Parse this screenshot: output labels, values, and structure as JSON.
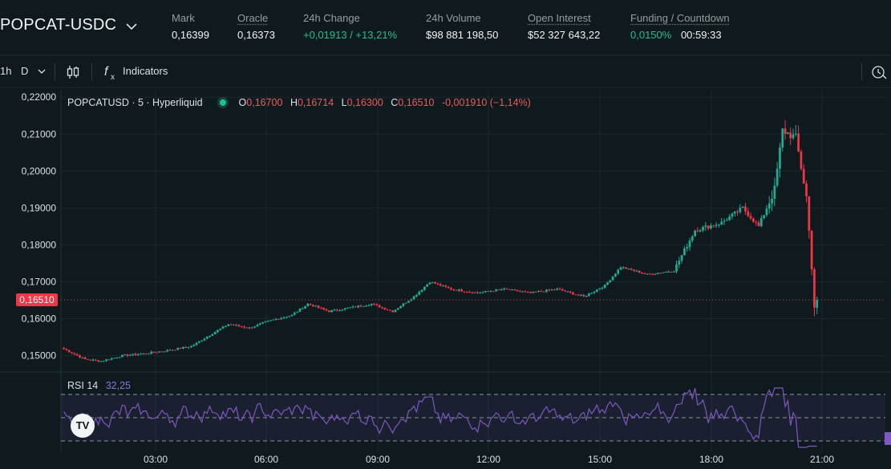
{
  "header": {
    "pair": "POPCAT-USDC",
    "stats": [
      {
        "label": "Mark",
        "value": "0,16399",
        "underline": false
      },
      {
        "label": "Oracle",
        "value": "0,16373",
        "underline": true
      },
      {
        "label": "24h Change",
        "value": "+0,01913 / +13,21%",
        "underline": false,
        "color": "#1fbf8f"
      },
      {
        "label": "24h Volume",
        "value": "$98 881 198,50",
        "underline": false
      },
      {
        "label": "Open Interest",
        "value": "$52 327 643,22",
        "underline": true
      },
      {
        "label": "Funding / Countdown",
        "value": "0,0150%",
        "value2": "00:59:33",
        "underline": true
      }
    ]
  },
  "toolbar": {
    "interval_1h": "1h",
    "interval_d": "D",
    "indicators_label": "Indicators"
  },
  "legend": {
    "symbol": "POPCATUSD · 5 · Hyperliquid",
    "o_label": "O",
    "o_value": "0,16700",
    "h_label": "H",
    "h_value": "0,16714",
    "l_label": "L",
    "l_value": "0,16300",
    "c_label": "C",
    "c_value": "0,16510",
    "change": "-0,001910 (−1,14%)"
  },
  "price_axis": [
    "0,22000",
    "0,21000",
    "0,20000",
    "0,19000",
    "0,18000",
    "0,17000",
    "0,16000",
    "0,15000"
  ],
  "price_axis_values": [
    0.22,
    0.21,
    0.2,
    0.19,
    0.18,
    0.17,
    0.16,
    0.15
  ],
  "last_price": {
    "label": "0,16510",
    "value": 0.1651
  },
  "time_axis": [
    "03:00",
    "06:00",
    "09:00",
    "12:00",
    "15:00",
    "18:00",
    "21:00"
  ],
  "rsi": {
    "label": "RSI",
    "period": "14",
    "value": "32,25"
  },
  "colors": {
    "up": "#22ab94",
    "down": "#f23645",
    "rsi": "#7e57c2",
    "background": "#0f1a1f"
  },
  "chart_data": {
    "type": "candlestick",
    "ylim": [
      0.146,
      0.222
    ],
    "keypoints_close": [
      [
        0,
        0.1518
      ],
      [
        8,
        0.149
      ],
      [
        14,
        0.1485
      ],
      [
        22,
        0.15
      ],
      [
        30,
        0.1505
      ],
      [
        40,
        0.1515
      ],
      [
        48,
        0.1525
      ],
      [
        56,
        0.156
      ],
      [
        62,
        0.1585
      ],
      [
        70,
        0.1575
      ],
      [
        78,
        0.1595
      ],
      [
        86,
        0.161
      ],
      [
        92,
        0.164
      ],
      [
        100,
        0.162
      ],
      [
        108,
        0.163
      ],
      [
        116,
        0.164
      ],
      [
        124,
        0.162
      ],
      [
        132,
        0.166
      ],
      [
        138,
        0.17
      ],
      [
        146,
        0.168
      ],
      [
        156,
        0.167
      ],
      [
        166,
        0.168
      ],
      [
        176,
        0.167
      ],
      [
        186,
        0.168
      ],
      [
        196,
        0.166
      ],
      [
        204,
        0.169
      ],
      [
        210,
        0.174
      ],
      [
        220,
        0.172
      ],
      [
        230,
        0.173
      ],
      [
        238,
        0.184
      ],
      [
        248,
        0.186
      ],
      [
        256,
        0.19
      ],
      [
        262,
        0.185
      ],
      [
        268,
        0.195
      ],
      [
        271,
        0.211
      ],
      [
        276,
        0.209
      ],
      [
        280,
        0.193
      ],
      [
        283,
        0.165
      ]
    ]
  }
}
